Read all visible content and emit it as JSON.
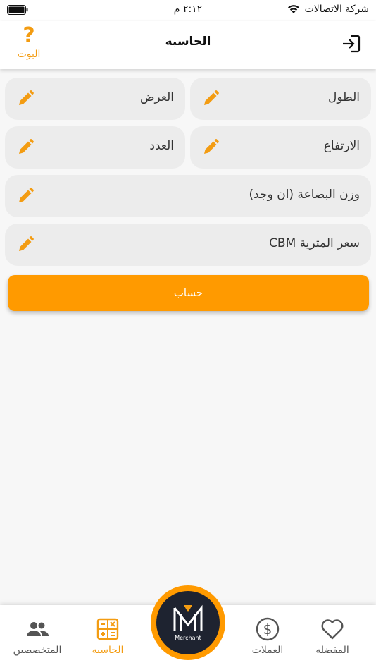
{
  "status_bar": {
    "carrier": "شركة الاتصالات",
    "time": "٢:١٢ م"
  },
  "nav": {
    "title": "الحاسبه",
    "bot_label": "البوت",
    "bot_symbol": "?"
  },
  "form": {
    "length_label": "الطول",
    "width_label": "العرض",
    "height_label": "الارتفاع",
    "count_label": "العدد",
    "weight_label": "وزن البضاعة (ان وجد)",
    "cbm_price_label": "سعر المترية CBM",
    "calculate_label": "حساب"
  },
  "tabs": {
    "favorites": "المفضله",
    "currencies": "العملات",
    "calculator": "الحاسبه",
    "specialists": "المتخصصين",
    "logo_text": "Merchant"
  },
  "colors": {
    "accent": "#ff9a00",
    "field_bg": "#ececec",
    "logo_bg": "#1e2330"
  }
}
